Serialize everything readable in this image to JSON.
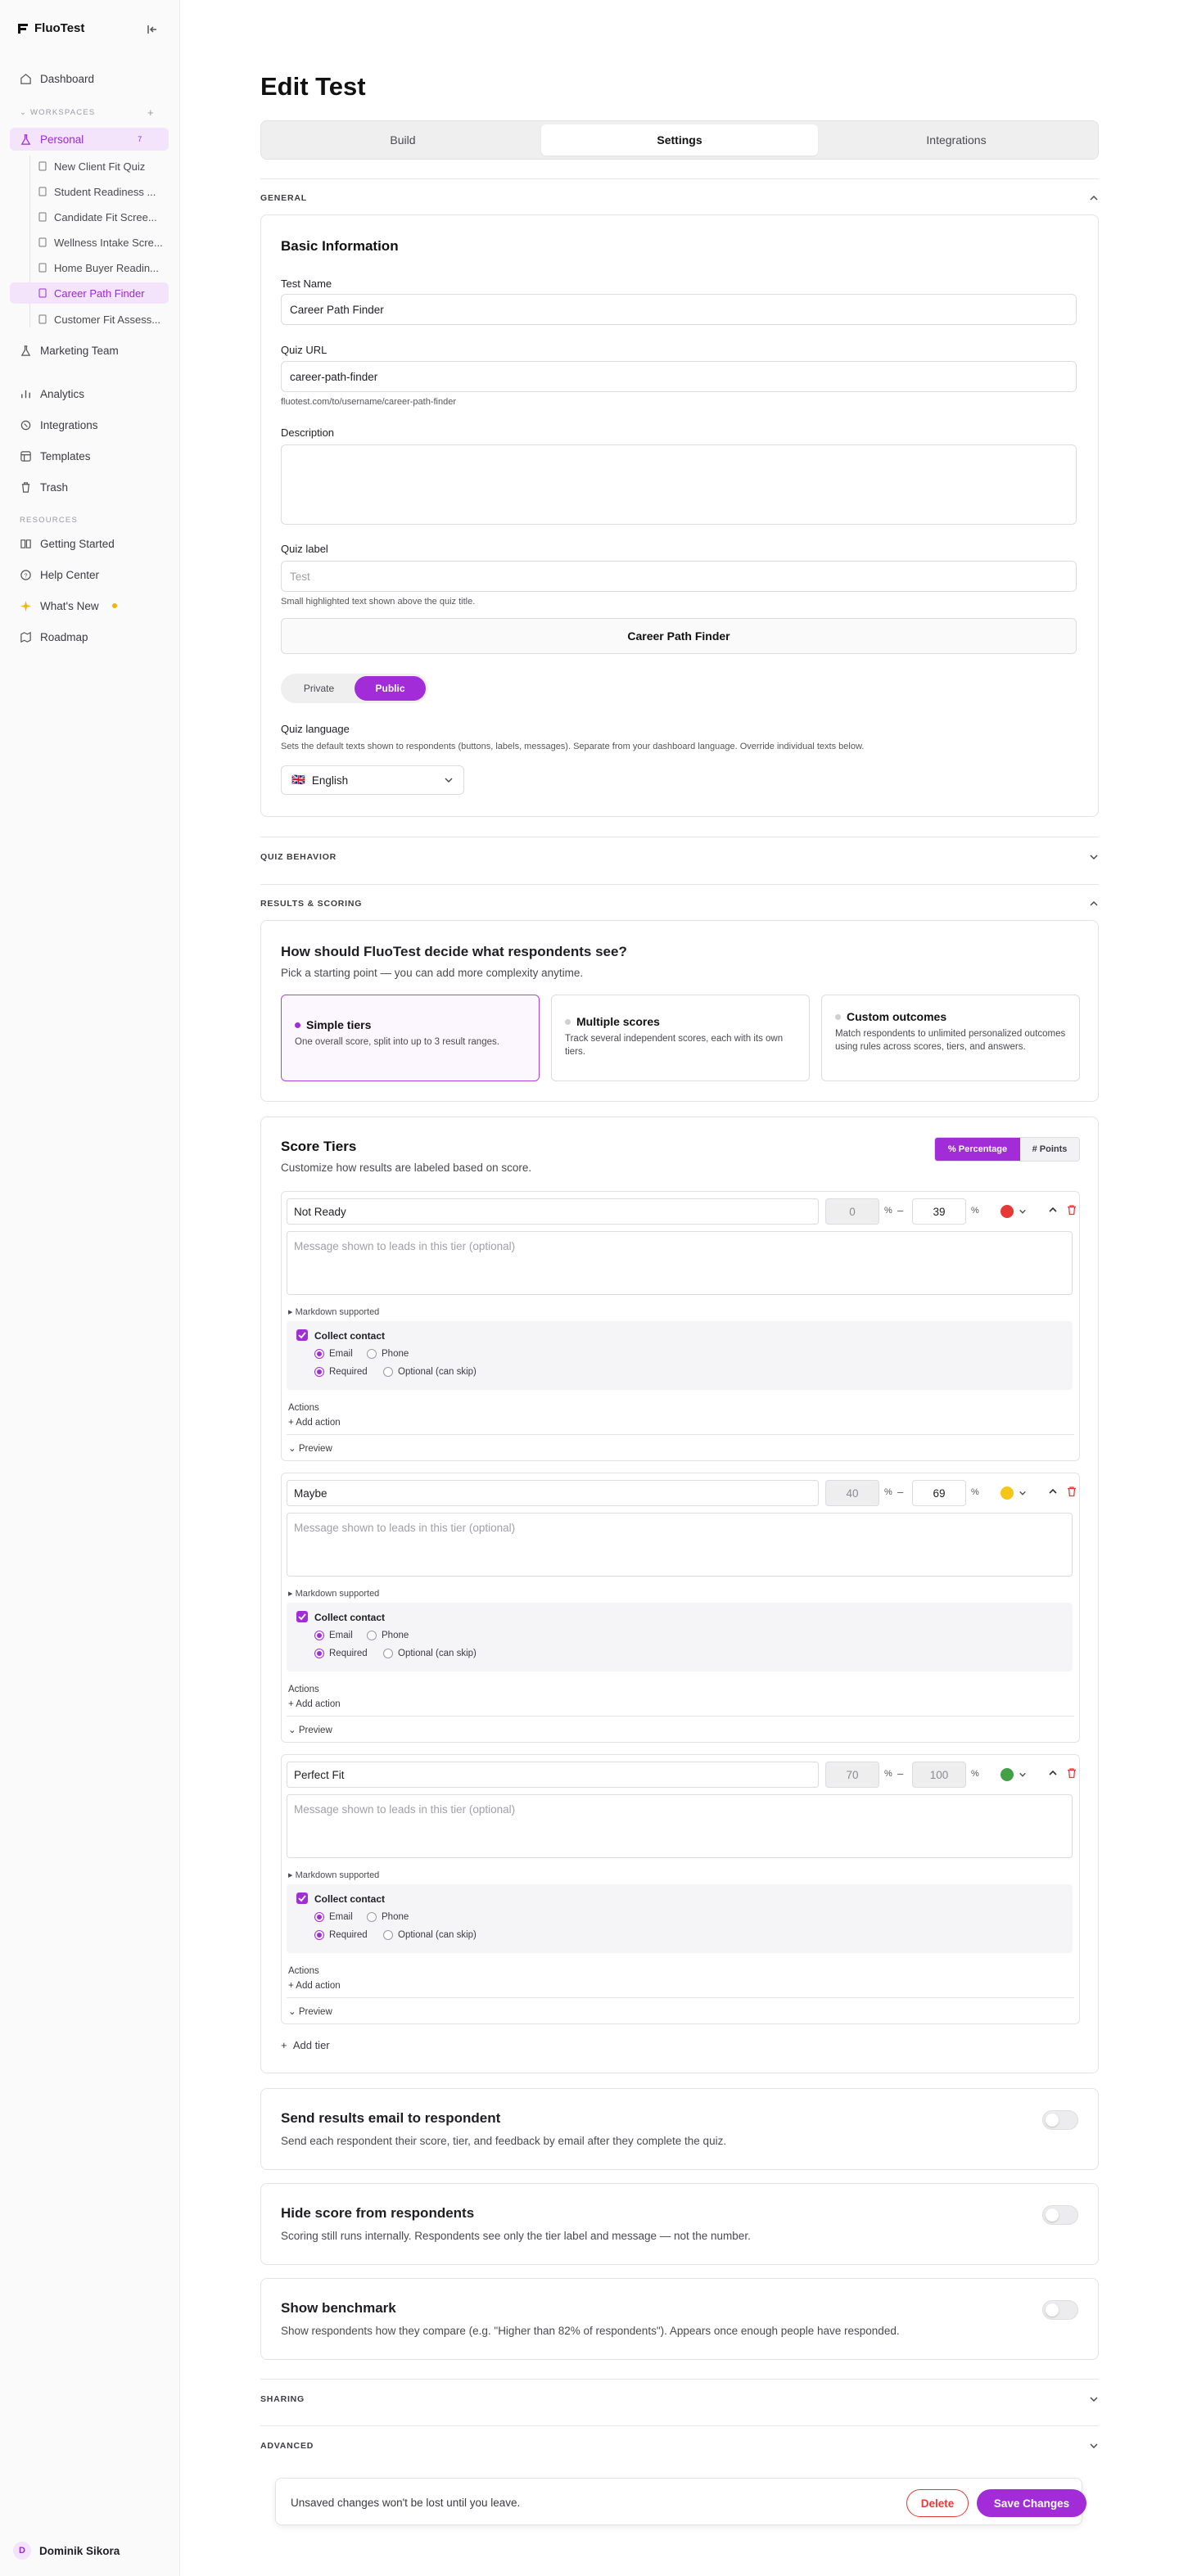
{
  "app": {
    "name": "FluoTest"
  },
  "sidebar": {
    "dashboard": "Dashboard",
    "workspaces_label": "WORKSPACES",
    "workspaces_add": "+",
    "personal": {
      "label": "Personal",
      "count": "7"
    },
    "quizzes": [
      {
        "label": "New Client Fit Quiz"
      },
      {
        "label": "Student Readiness ..."
      },
      {
        "label": "Candidate Fit Scree..."
      },
      {
        "label": "Wellness Intake Scre..."
      },
      {
        "label": "Home Buyer Readin..."
      },
      {
        "label": "Career Path Finder"
      },
      {
        "label": "Customer Fit Assess..."
      }
    ],
    "marketing_team": "Marketing Team",
    "analytics": "Analytics",
    "integrations": "Integrations",
    "templates": "Templates",
    "trash": "Trash",
    "resources_label": "RESOURCES",
    "getting_started": "Getting Started",
    "help_center": "Help Center",
    "whats_new": "What's New",
    "roadmap": "Roadmap",
    "user": {
      "initial": "D",
      "name": "Dominik Sikora"
    }
  },
  "page": {
    "title": "Edit Test",
    "tabs": [
      {
        "label": "Build"
      },
      {
        "label": "Settings"
      },
      {
        "label": "Integrations"
      }
    ]
  },
  "general": {
    "section_label": "GENERAL",
    "card_title": "Basic Information",
    "test_name_label": "Test Name",
    "test_name_value": "Career Path Finder",
    "quiz_url_label": "Quiz URL",
    "quiz_url_value": "career-path-finder",
    "quiz_url_help": "fluotest.com/to/username/career-path-finder",
    "description_label": "Description",
    "quiz_label_label": "Quiz label",
    "quiz_label_placeholder": "Test",
    "quiz_label_help": "Small highlighted text shown above the quiz title.",
    "quiz_label_preview": "Career Path Finder",
    "visibility": {
      "private": "Private",
      "public": "Public"
    },
    "language_label": "Quiz language",
    "language_help": "Sets the default texts shown to respondents (buttons, labels, messages). Separate from your dashboard language. Override individual texts below.",
    "language_value": "English",
    "language_flag": "🇬🇧"
  },
  "quiz_behavior": {
    "section_label": "QUIZ BEHAVIOR"
  },
  "results": {
    "section_label": "RESULTS & SCORING",
    "question": "How should FluoTest decide what respondents see?",
    "question_sub": "Pick a starting point — you can add more complexity anytime.",
    "options": [
      {
        "title": "Simple tiers",
        "desc": "One overall score, split into up to 3 result ranges."
      },
      {
        "title": "Multiple scores",
        "desc": "Track several independent scores, each with its own tiers."
      },
      {
        "title": "Custom outcomes",
        "desc": "Match respondents to unlimited personalized outcomes using rules across scores, tiers, and answers."
      }
    ],
    "score_tiers_title": "Score Tiers",
    "score_tiers_sub": "Customize how results are labeled based on score.",
    "unit_percentage": "% Percentage",
    "unit_points": "# Points",
    "pct_sign": "%",
    "range_dash": "–",
    "tiers": [
      {
        "name": "Not Ready",
        "min": "0",
        "max": "39",
        "color": "#e53935"
      },
      {
        "name": "Maybe",
        "min": "40",
        "max": "69",
        "color": "#f5c518"
      },
      {
        "name": "Perfect Fit",
        "min": "70",
        "max": "100",
        "color": "#43a047"
      }
    ],
    "tier_message_placeholder": "Message shown to leads in this tier (optional)",
    "markdown_note": "▸ Markdown supported",
    "collect_contact": "Collect contact",
    "email": "Email",
    "phone": "Phone",
    "required": "Required",
    "optional": "Optional (can skip)",
    "actions_label": "Actions",
    "add_action": "+ Add action",
    "preview": "Preview",
    "add_tier": "Add tier"
  },
  "toggles": [
    {
      "title": "Send results email to respondent",
      "desc": "Send each respondent their score, tier, and feedback by email after they complete the quiz."
    },
    {
      "title": "Hide score from respondents",
      "desc": "Scoring still runs internally. Respondents see only the tier label and message — not the number."
    },
    {
      "title": "Show benchmark",
      "desc": "Show respondents how they compare (e.g. \"Higher than 82% of respondents\"). Appears once enough people have responded."
    }
  ],
  "sharing": {
    "section_label": "SHARING"
  },
  "advanced": {
    "section_label": "ADVANCED"
  },
  "savebar": {
    "text": "Unsaved changes won't be lost until you leave.",
    "delete": "Delete",
    "save": "Save Changes"
  },
  "colors": {
    "accent": "#a32cd9",
    "accent_soft": "#f3e3fb",
    "danger": "#e53935"
  }
}
